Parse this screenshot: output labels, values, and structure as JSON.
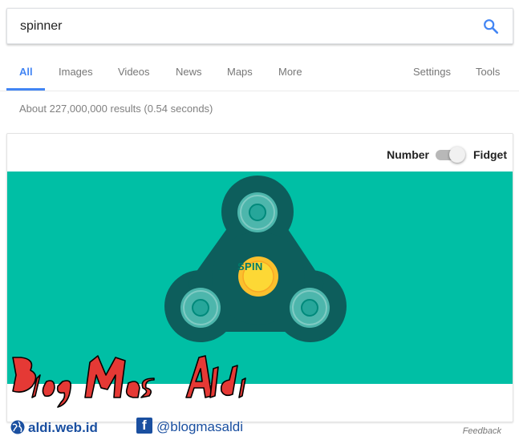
{
  "search": {
    "query": "spinner",
    "icon": "search-icon"
  },
  "tabs": {
    "all": "All",
    "images": "Images",
    "videos": "Videos",
    "news": "News",
    "maps": "Maps",
    "more": "More",
    "settings": "Settings",
    "tools": "Tools"
  },
  "result_stats": "About 227,000,000 results (0.54 seconds)",
  "spinner_card": {
    "toggle_left": "Number",
    "toggle_right": "Fidget",
    "toggle_selected": "Fidget",
    "spin_label": "SPIN",
    "feedback": "Feedback"
  },
  "watermark": {
    "logo_text": "Blog Mas Aldi",
    "site": "aldi.web.id",
    "facebook": "@blogmasaldi"
  },
  "colors": {
    "accent": "#4285f4",
    "stage": "#00bfa5",
    "spinner_body": "#0d5e5c",
    "bearing_ring": "#4db6ac",
    "bearing_center": "#26a69a",
    "hub": "#fdd835",
    "spin_text": "#00796b",
    "watermark_red": "#e53935",
    "watermark_blue": "#1a4fa0"
  }
}
